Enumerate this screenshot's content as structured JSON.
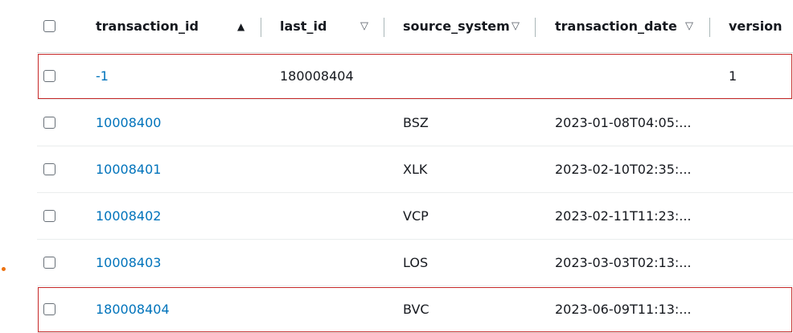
{
  "columns": {
    "transaction_id": "transaction_id",
    "last_id": "last_id",
    "source_system": "source_system",
    "transaction_date": "transaction_date",
    "version": "version"
  },
  "sort": {
    "asc_icon": "▲",
    "desc_icon": "▽"
  },
  "rows": [
    {
      "transaction_id": "-1",
      "last_id": "180008404",
      "source_system": "",
      "transaction_date": "",
      "version": "1"
    },
    {
      "transaction_id": "10008400",
      "last_id": "",
      "source_system": "BSZ",
      "transaction_date": "2023-01-08T04:05:...",
      "version": ""
    },
    {
      "transaction_id": "10008401",
      "last_id": "",
      "source_system": "XLK",
      "transaction_date": "2023-02-10T02:35:...",
      "version": ""
    },
    {
      "transaction_id": "10008402",
      "last_id": "",
      "source_system": "VCP",
      "transaction_date": "2023-02-11T11:23:...",
      "version": ""
    },
    {
      "transaction_id": "10008403",
      "last_id": "",
      "source_system": "LOS",
      "transaction_date": "2023-03-03T02:13:...",
      "version": ""
    },
    {
      "transaction_id": "180008404",
      "last_id": "",
      "source_system": "BVC",
      "transaction_date": "2023-06-09T11:13:...",
      "version": ""
    }
  ],
  "colors": {
    "link": "#0073bb",
    "highlight_border": "#c62828",
    "indicator_dot": "#ec7211"
  }
}
